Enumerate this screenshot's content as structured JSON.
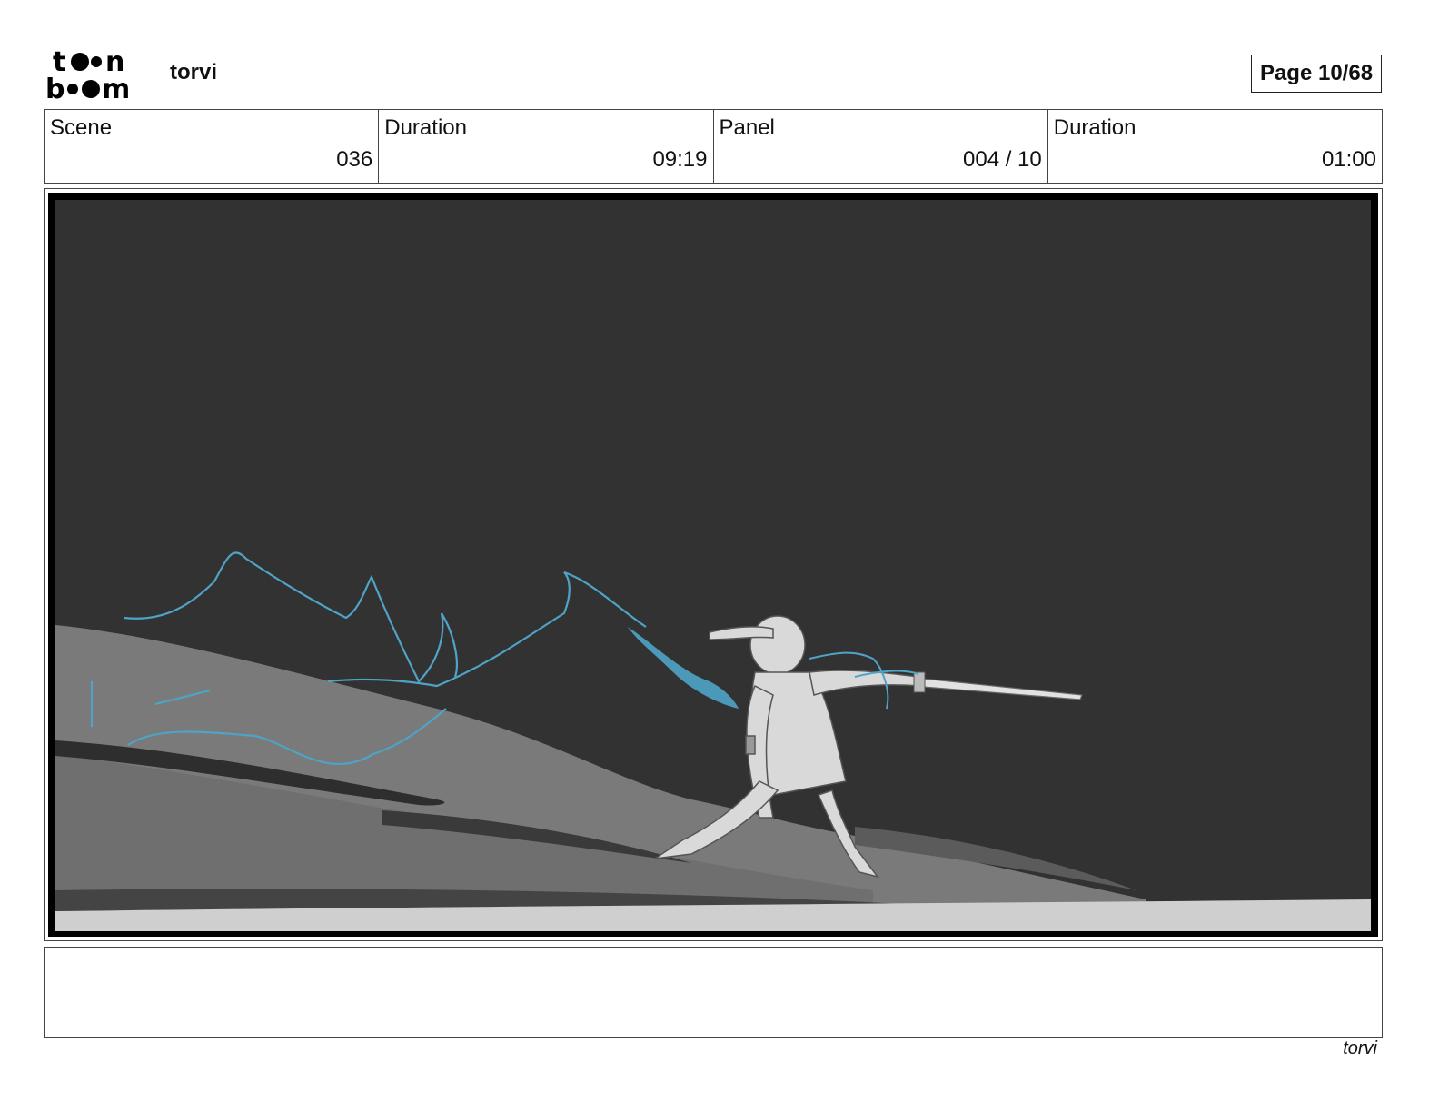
{
  "header": {
    "logo": {
      "text_line1": "toon",
      "text_line2": "boom",
      "icon": "toon-boom-logo"
    },
    "project_title": "torvi",
    "page_indicator": "Page 10/68"
  },
  "info": {
    "scene_label": "Scene",
    "scene_value": "036",
    "scene_duration_label": "Duration",
    "scene_duration_value": "09:19",
    "panel_label": "Panel",
    "panel_value": "004 / 10",
    "panel_duration_label": "Duration",
    "panel_duration_value": "01:00"
  },
  "panel_image": {
    "description_icon": "storyboard-sketch-image",
    "colors": {
      "sky": "#323232",
      "ground_mid": "#7a7a7a",
      "ground_light": "#cfcfcf",
      "character": "#d9d9d9",
      "ice_blue": "#4fa3c6"
    }
  },
  "notes": {
    "text": ""
  },
  "footer": {
    "project_title": "torvi"
  }
}
